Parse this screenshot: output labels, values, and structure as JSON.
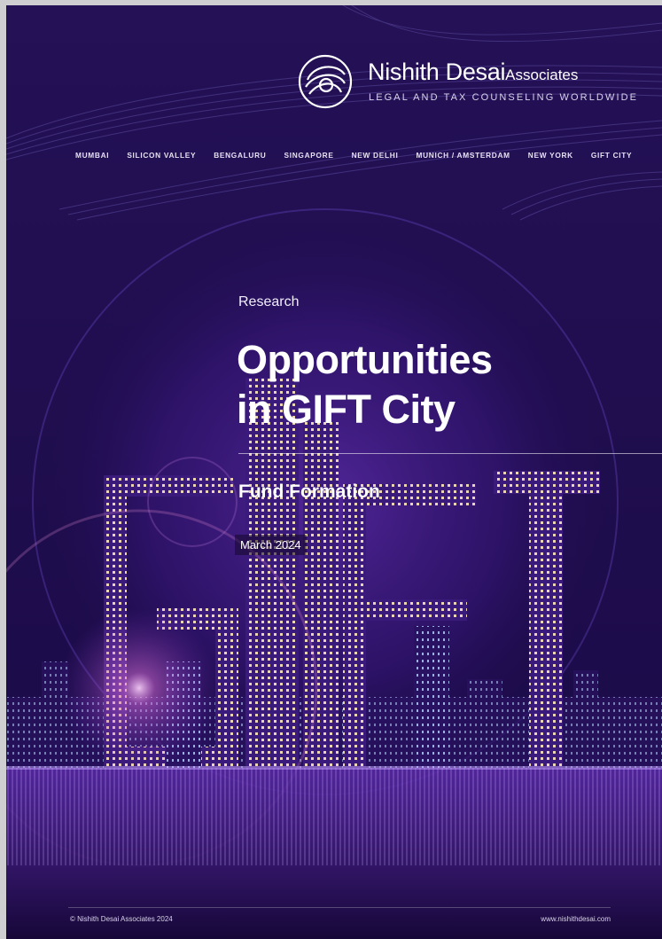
{
  "brand": {
    "name": "Nishith Desai",
    "name_suffix": "Associates",
    "tagline": "LEGAL AND TAX COUNSELING WORLDWIDE"
  },
  "locations": [
    "MUMBAI",
    "SILICON VALLEY",
    "BENGALURU",
    "SINGAPORE",
    "NEW DELHI",
    "MUNICH / AMSTERDAM",
    "NEW YORK",
    "GIFT CITY"
  ],
  "cover": {
    "category": "Research",
    "title_line1": "Opportunities",
    "title_line2": "in GIFT City",
    "subtitle": "Fund Formation",
    "date": "March 2024"
  },
  "footer": {
    "copyright": "© Nishith Desai Associates 2024",
    "website": "www.nishithdesai.com"
  },
  "colors": {
    "background": "#1c0a4a",
    "accent_purple": "#6a2cc4",
    "city_glow": "#d4a6ff",
    "text": "#ffffff"
  },
  "icons": {
    "logo": "swirl-circle-logo-icon"
  }
}
